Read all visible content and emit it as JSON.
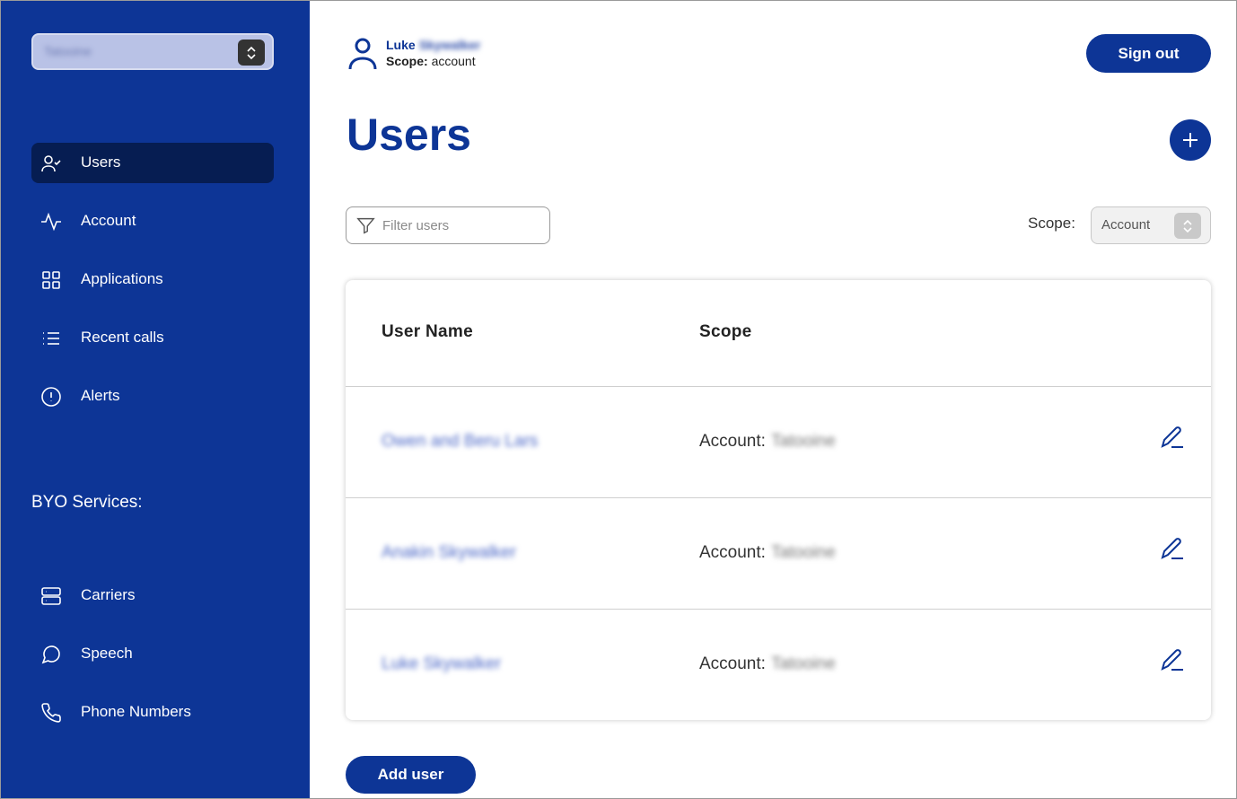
{
  "sidebar": {
    "account_selector": {
      "value": "Tatooine"
    },
    "items": [
      {
        "label": "Users",
        "icon": "user-check-icon",
        "active": true
      },
      {
        "label": "Account",
        "icon": "activity-icon"
      },
      {
        "label": "Applications",
        "icon": "grid-icon"
      },
      {
        "label": "Recent calls",
        "icon": "list-icon"
      },
      {
        "label": "Alerts",
        "icon": "alert-circle-icon"
      }
    ],
    "byo_label": "BYO Services:",
    "byo_items": [
      {
        "label": "Carriers",
        "icon": "server-icon"
      },
      {
        "label": "Speech",
        "icon": "message-circle-icon"
      },
      {
        "label": "Phone Numbers",
        "icon": "phone-icon"
      }
    ]
  },
  "header": {
    "user_first": "Luke",
    "user_last": "Skywalker",
    "scope_label": "Scope:",
    "scope_value": "account",
    "signout_label": "Sign out"
  },
  "main": {
    "title": "Users",
    "filter_placeholder": "Filter users",
    "scope_filter_label": "Scope:",
    "scope_filter_value": "Account",
    "table": {
      "columns": [
        "User Name",
        "Scope"
      ],
      "rows": [
        {
          "name": "Owen and Beru Lars",
          "scope_prefix": "Account:",
          "scope_value": "Tatooine"
        },
        {
          "name": "Anakin Skywalker",
          "scope_prefix": "Account:",
          "scope_value": "Tatooine"
        },
        {
          "name": "Luke Skywalker",
          "scope_prefix": "Account:",
          "scope_value": "Tatooine"
        }
      ]
    },
    "add_user_label": "Add user"
  },
  "colors": {
    "brand": "#0d3596",
    "active_nav": "#061d52",
    "link": "#4c68c7"
  }
}
